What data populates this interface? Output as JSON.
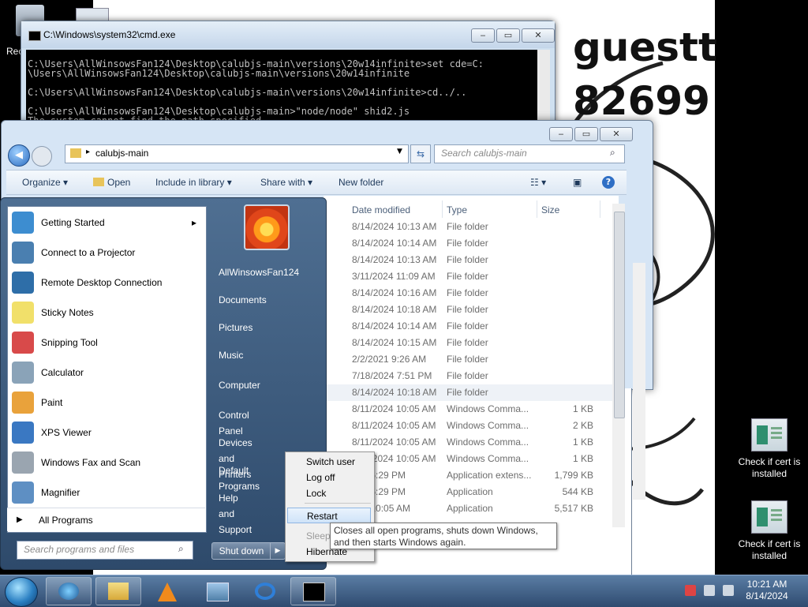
{
  "desktop": {
    "guest_text": "guestt 82699",
    "recycle_partial": "Rec",
    "icons": [
      {
        "label": "Check if cert is installed"
      },
      {
        "label": "Check if cert is installed"
      }
    ]
  },
  "cmd": {
    "title": "C:\\Windows\\system32\\cmd.exe",
    "lines": [
      "",
      "C:\\Users\\AllWinsowsFan124\\Desktop\\calubjs-main\\versions\\20w14infinite>set cde=C:",
      "\\Users\\AllWinsowsFan124\\Desktop\\calubjs-main\\versions\\20w14infinite",
      "",
      "C:\\Users\\AllWinsowsFan124\\Desktop\\calubjs-main\\versions\\20w14infinite>cd../..",
      "",
      "C:\\Users\\AllWinsowsFan124\\Desktop\\calubjs-main>\"node/node\" shid2.js",
      "The system cannot find the path specified."
    ]
  },
  "explorer": {
    "address": "calubjs-main",
    "search_placeholder": "Search calubjs-main",
    "toolbar": {
      "organize": "Organize",
      "open": "Open",
      "include": "Include in library",
      "share": "Share with",
      "new_folder": "New folder"
    },
    "columns": {
      "date": "Date modified",
      "type": "Type",
      "size": "Size"
    },
    "rows": [
      {
        "date": "8/14/2024 10:13 AM",
        "type": "File folder",
        "size": ""
      },
      {
        "date": "8/14/2024 10:14 AM",
        "type": "File folder",
        "size": ""
      },
      {
        "date": "8/14/2024 10:13 AM",
        "type": "File folder",
        "size": ""
      },
      {
        "date": "3/11/2024 11:09 AM",
        "type": "File folder",
        "size": ""
      },
      {
        "date": "8/14/2024 10:16 AM",
        "type": "File folder",
        "size": ""
      },
      {
        "date": "8/14/2024 10:18 AM",
        "type": "File folder",
        "size": ""
      },
      {
        "date": "8/14/2024 10:14 AM",
        "type": "File folder",
        "size": ""
      },
      {
        "date": "8/14/2024 10:15 AM",
        "type": "File folder",
        "size": ""
      },
      {
        "date": "2/2/2021 9:26 AM",
        "type": "File folder",
        "size": ""
      },
      {
        "date": "7/18/2024 7:51 PM",
        "type": "File folder",
        "size": ""
      },
      {
        "date": "8/14/2024 10:18 AM",
        "type": "File folder",
        "size": ""
      },
      {
        "date": "8/11/2024 10:05 AM",
        "type": "Windows Comma...",
        "size": "1 KB"
      },
      {
        "date": "8/11/2024 10:05 AM",
        "type": "Windows Comma...",
        "size": "2 KB"
      },
      {
        "date": "8/11/2024 10:05 AM",
        "type": "Windows Comma...",
        "size": "1 KB"
      },
      {
        "date": "8/11/2024 10:05 AM",
        "type": "Windows Comma...",
        "size": "1 KB"
      },
      {
        "date": "024 6:29 PM",
        "type": "Application extens...",
        "size": "1,799 KB"
      },
      {
        "date": "024 6:29 PM",
        "type": "Application",
        "size": "544 KB"
      },
      {
        "date": "024 10:05 AM",
        "type": "Application",
        "size": "5,517 KB"
      }
    ]
  },
  "start_menu": {
    "programs": [
      {
        "label": "Getting Started",
        "arrow": "▸",
        "color": "#3d8dd0"
      },
      {
        "label": "Connect to a Projector",
        "arrow": "",
        "color": "#4a7fb0"
      },
      {
        "label": "Remote Desktop Connection",
        "arrow": "",
        "color": "#2e6ea8"
      },
      {
        "label": "Sticky Notes",
        "arrow": "",
        "color": "#f1e06a"
      },
      {
        "label": "Snipping Tool",
        "arrow": "",
        "color": "#d84a4a"
      },
      {
        "label": "Calculator",
        "arrow": "",
        "color": "#8aa3b8"
      },
      {
        "label": "Paint",
        "arrow": "",
        "color": "#e9a23b"
      },
      {
        "label": "XPS Viewer",
        "arrow": "",
        "color": "#3a78c2"
      },
      {
        "label": "Windows Fax and Scan",
        "arrow": "",
        "color": "#9aa5b0"
      },
      {
        "label": "Magnifier",
        "arrow": "",
        "color": "#5e8fc3"
      }
    ],
    "all_programs": "All Programs",
    "search_placeholder": "Search programs and files",
    "right_items": [
      "AllWinsowsFan124",
      "Documents",
      "Pictures",
      "Music",
      "Computer",
      "Control Panel",
      "Devices and Printers",
      "Default Programs",
      "Help and Support"
    ],
    "shutdown": "Shut down",
    "shutdown_arrow": "▶"
  },
  "shutdown_menu": {
    "items": [
      "Switch user",
      "Log off",
      "Lock",
      "Restart",
      "Sleep",
      "Hibernate"
    ],
    "tooltip": "Closes all open programs, shuts down Windows, and then starts Windows again."
  },
  "taskbar": {
    "time": "10:21 AM",
    "date": "8/14/2024"
  }
}
